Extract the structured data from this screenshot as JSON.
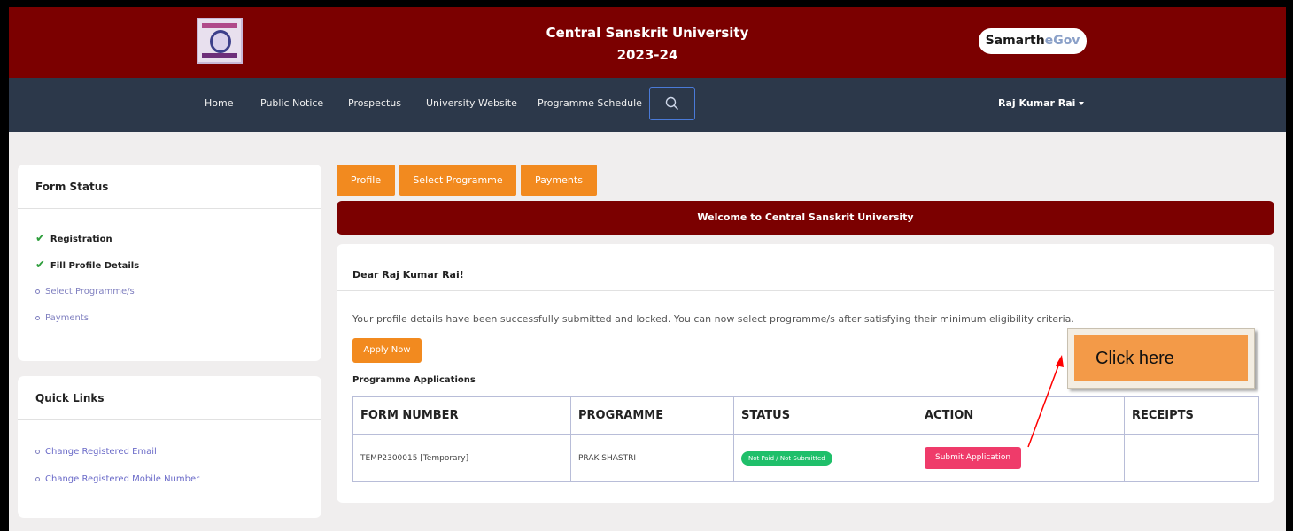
{
  "header": {
    "title": "Central Sanskrit University",
    "year": "2023-24",
    "brand_main": "Samarth",
    "brand_accent": "eGov"
  },
  "nav": {
    "items": [
      "Home",
      "Public Notice",
      "Prospectus",
      "University Website",
      "Programme Schedule"
    ],
    "user": "Raj Kumar Rai"
  },
  "form_status": {
    "title": "Form Status",
    "items": [
      {
        "label": "Registration",
        "done": true
      },
      {
        "label": "Fill Profile Details",
        "done": true
      },
      {
        "label": "Select Programme/s",
        "done": false
      },
      {
        "label": "Payments",
        "done": false
      }
    ]
  },
  "quick_links": {
    "title": "Quick Links",
    "items": [
      "Change Registered Email",
      "Change Registered Mobile Number"
    ]
  },
  "tabs": [
    "Profile",
    "Select Programme",
    "Payments"
  ],
  "welcome": "Welcome to Central Sanskrit University",
  "main": {
    "greeting": "Dear Raj Kumar Rai!",
    "message": "Your profile details have been successfully submitted and locked. You can now select programme/s after satisfying their minimum eligibility criteria.",
    "apply_label": "Apply Now",
    "apps_label": "Programme Applications",
    "table": {
      "headers": [
        "FORM NUMBER",
        "PROGRAMME",
        "STATUS",
        "ACTION",
        "RECEIPTS"
      ],
      "rows": [
        {
          "form_number": "TEMP2300015 [Temporary]",
          "programme": "PRAK SHASTRI",
          "status": "Not Paid / Not Submitted",
          "action": "Submit Application",
          "receipts": ""
        }
      ]
    }
  },
  "callout": "Click here",
  "colors": {
    "maroon": "#7b0000",
    "navy": "#2c384a",
    "orange": "#f28a1f",
    "green": "#1fbf6a",
    "pink": "#ef3b6a"
  },
  "icons": [
    "search-icon",
    "check-icon",
    "caret-down-icon",
    "logo-emblem"
  ]
}
